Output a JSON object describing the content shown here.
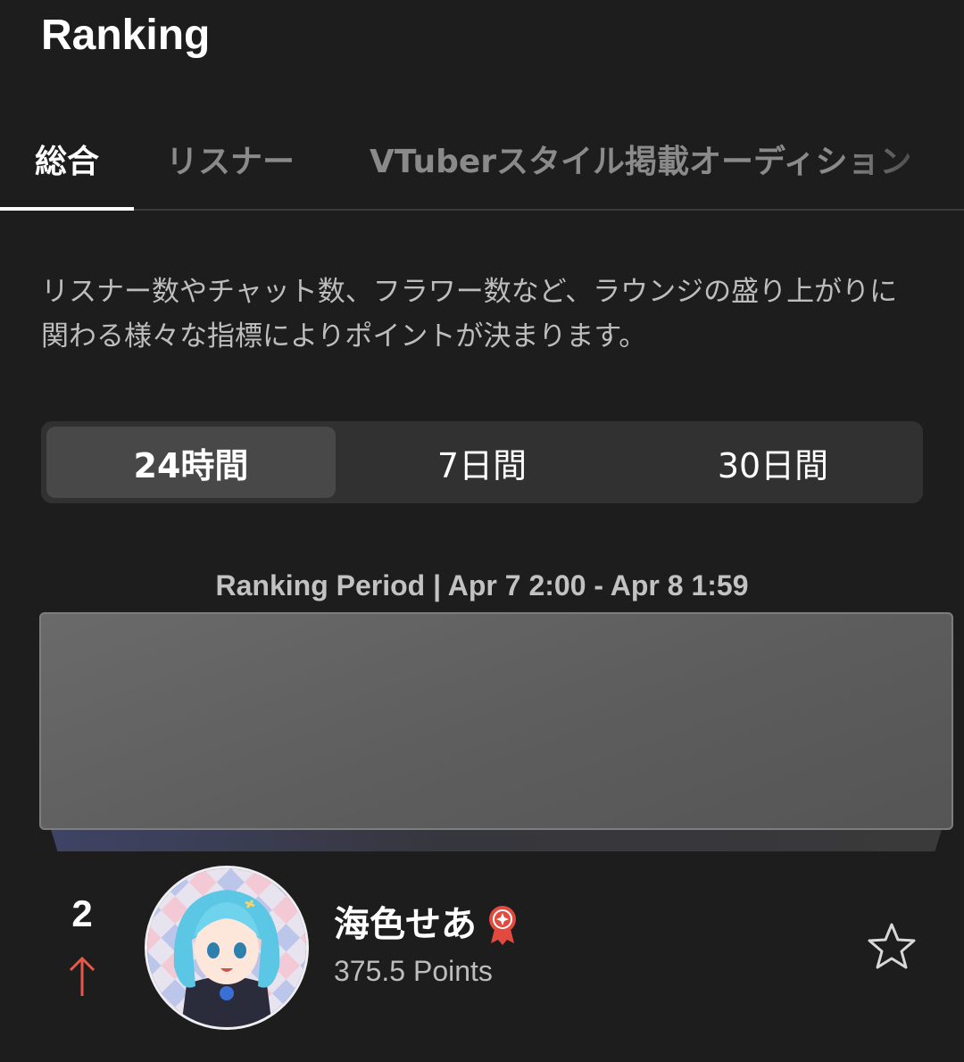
{
  "header": {
    "title": "Ranking"
  },
  "tabs": [
    {
      "label": "総合",
      "active": true
    },
    {
      "label": "リスナー",
      "active": false
    },
    {
      "label": "VTuberスタイル掲載オーディション",
      "active": false
    }
  ],
  "description": "リスナー数やチャット数、フラワー数など、ラウンジの盛り上がりに関わる様々な指標によりポイントが決まります。",
  "period_tabs": [
    {
      "label": "24時間",
      "active": true
    },
    {
      "label": "7日間",
      "active": false
    },
    {
      "label": "30日間",
      "active": false
    }
  ],
  "ranking_period": "Ranking Period | Apr 7 2:00 - Apr 8 1:59",
  "entries": [
    {
      "rank": "2",
      "trend": "up",
      "name": "海色せあ",
      "points": "375.5 Points",
      "favorited": false
    }
  ],
  "colors": {
    "background": "#1d1d1d",
    "trend_up": "#e8584a",
    "badge": "#e24a3f"
  },
  "icons": {
    "trend": "arrow-up-icon",
    "badge": "ribbon-badge-icon",
    "favorite": "star-outline-icon"
  }
}
